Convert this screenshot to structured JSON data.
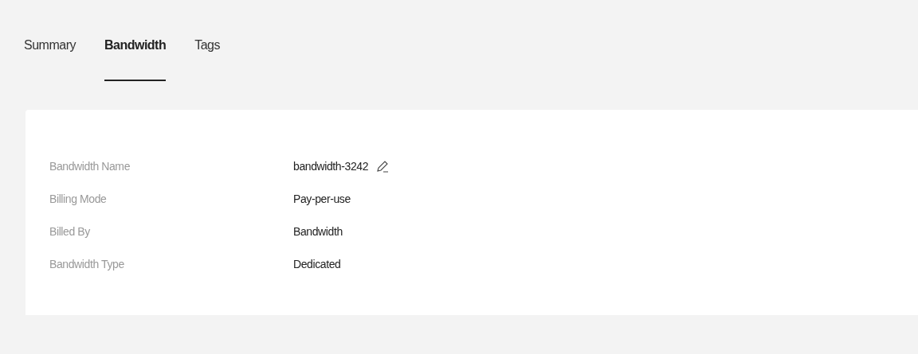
{
  "tabs": [
    {
      "label": "Summary",
      "selected": false
    },
    {
      "label": "Bandwidth",
      "selected": true
    },
    {
      "label": "Tags",
      "selected": false
    }
  ],
  "details": [
    {
      "label": "Bandwidth Name",
      "value": "bandwidth-3242",
      "editable": true
    },
    {
      "label": "Billing Mode",
      "value": "Pay-per-use",
      "editable": false
    },
    {
      "label": "Billed By",
      "value": "Bandwidth",
      "editable": false
    },
    {
      "label": "Bandwidth Type",
      "value": "Dedicated",
      "editable": false
    }
  ]
}
